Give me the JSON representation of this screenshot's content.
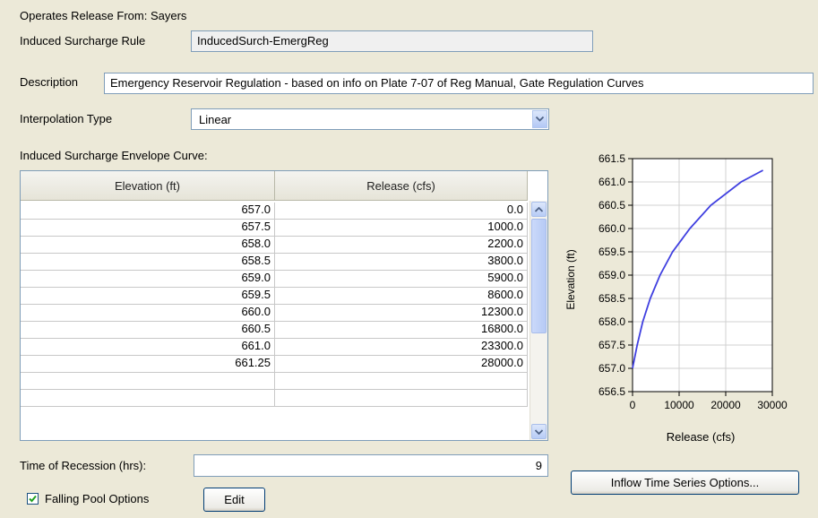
{
  "operates_release": {
    "label": "Operates Release From:",
    "value": "Sayers"
  },
  "rule": {
    "label": "Induced Surcharge Rule",
    "value": "InducedSurch-EmergReg"
  },
  "description": {
    "label": "Description",
    "value": "Emergency Reservoir Regulation - based on info on Plate 7-07 of Reg Manual, Gate Regulation Curves"
  },
  "interpolation": {
    "label": "Interpolation Type",
    "selected": "Linear"
  },
  "envelope_label": "Induced Surcharge Envelope Curve:",
  "table": {
    "headers": [
      "Elevation (ft)",
      "Release (cfs)"
    ],
    "rows": [
      [
        "657.0",
        "0.0"
      ],
      [
        "657.5",
        "1000.0"
      ],
      [
        "658.0",
        "2200.0"
      ],
      [
        "658.5",
        "3800.0"
      ],
      [
        "659.0",
        "5900.0"
      ],
      [
        "659.5",
        "8600.0"
      ],
      [
        "660.0",
        "12300.0"
      ],
      [
        "660.5",
        "16800.0"
      ],
      [
        "661.0",
        "23300.0"
      ],
      [
        "661.25",
        "28000.0"
      ],
      [
        "",
        ""
      ],
      [
        "",
        ""
      ]
    ]
  },
  "recession": {
    "label": "Time of Recession (hrs):",
    "value": "9"
  },
  "falling_pool": {
    "label": "Falling Pool Options",
    "checked": true,
    "edit_label": "Edit"
  },
  "inflow_button": "Inflow Time Series Options...",
  "chart_data": {
    "type": "line",
    "xlabel": "Release (cfs)",
    "ylabel": "Elevation (ft)",
    "xlim": [
      0,
      30000
    ],
    "ylim": [
      656.5,
      661.5
    ],
    "x_ticks": [
      "0",
      "10000",
      "20000",
      "30000"
    ],
    "y_ticks": [
      "661.5",
      "661.0",
      "660.5",
      "660.0",
      "659.5",
      "659.0",
      "658.5",
      "658.0",
      "657.5",
      "657.0",
      "656.5"
    ],
    "grid": true,
    "line_color": "#4040E0",
    "points": [
      [
        0,
        657.0
      ],
      [
        1000,
        657.5
      ],
      [
        2200,
        658.0
      ],
      [
        3800,
        658.5
      ],
      [
        5900,
        659.0
      ],
      [
        8600,
        659.5
      ],
      [
        12300,
        660.0
      ],
      [
        16800,
        660.5
      ],
      [
        23300,
        661.0
      ],
      [
        28000,
        661.25
      ]
    ]
  }
}
